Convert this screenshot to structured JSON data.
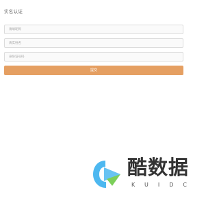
{
  "page": {
    "title": "实名认证"
  },
  "form": {
    "fields": [
      {
        "placeholder": "请填昵称"
      },
      {
        "placeholder": "真实姓名"
      },
      {
        "placeholder": "身份证号码"
      }
    ],
    "submit_label": "提交"
  },
  "watermark": {
    "text": "酷数据",
    "subtext": "KUIDC"
  },
  "colors": {
    "accent": "#e59f62",
    "field_border": "#dcdcdc",
    "field_bg": "#fafafa",
    "logo_blue": "#4db8f0",
    "logo_green": "#7ccf5a"
  }
}
